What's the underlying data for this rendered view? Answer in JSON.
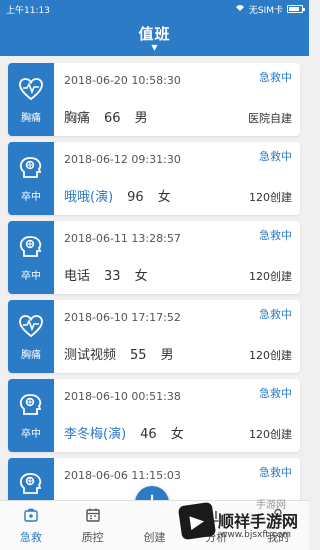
{
  "status_bar": {
    "time": "上午11:13",
    "carrier": "无SIM卡"
  },
  "header": {
    "title": "值班"
  },
  "cards": [
    {
      "icon": "heart-pulse-icon",
      "category": "胸痛",
      "time": "2018-06-20 10:58:30",
      "status": "急救中",
      "name": "胸痛",
      "name_link": false,
      "age": "66",
      "gender": "男",
      "source": "医院自建"
    },
    {
      "icon": "brain-icon",
      "category": "卒中",
      "time": "2018-06-12 09:31:30",
      "status": "急救中",
      "name": "哦哦(演)",
      "name_link": true,
      "age": "96",
      "gender": "女",
      "source": "120创建"
    },
    {
      "icon": "brain-icon",
      "category": "卒中",
      "time": "2018-06-11 13:28:57",
      "status": "急救中",
      "name": "电话",
      "name_link": false,
      "age": "33",
      "gender": "女",
      "source": "120创建"
    },
    {
      "icon": "heart-pulse-icon",
      "category": "胸痛",
      "time": "2018-06-10 17:17:52",
      "status": "急救中",
      "name": "测试视频",
      "name_link": false,
      "age": "55",
      "gender": "男",
      "source": "120创建"
    },
    {
      "icon": "brain-icon",
      "category": "卒中",
      "time": "2018-06-10 00:51:38",
      "status": "急救中",
      "name": "李冬梅(演)",
      "name_link": true,
      "age": "46",
      "gender": "女",
      "source": "120创建"
    },
    {
      "icon": "brain-icon",
      "category": "卒中",
      "time": "2018-06-06 11:15:03",
      "status": "急救中",
      "name": "",
      "name_link": false,
      "age": "",
      "gender": "",
      "source": ""
    }
  ],
  "tabs": [
    {
      "label": "急救",
      "icon": "first-aid-icon",
      "active": true
    },
    {
      "label": "质控",
      "icon": "calendar-icon",
      "active": false
    },
    {
      "label": "创建",
      "icon": "plus-icon",
      "active": false
    },
    {
      "label": "分析",
      "icon": "chart-icon",
      "active": false
    },
    {
      "label": "我的",
      "icon": "user-icon",
      "active": false
    }
  ],
  "watermark": {
    "brand": "顺祥手游网",
    "url": "www.bjsxft.com",
    "small": "手游网"
  },
  "colors": {
    "primary": "#2c7bc6"
  }
}
